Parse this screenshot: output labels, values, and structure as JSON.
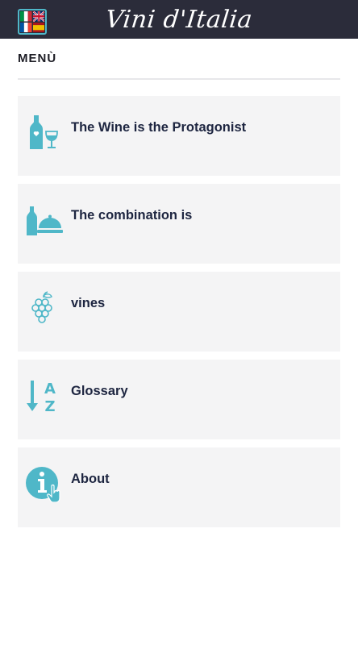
{
  "header": {
    "title": "Vini d'Italia",
    "language_button": {
      "flags": [
        "italy-flag",
        "uk-flag",
        "france-flag",
        "spain-flag"
      ]
    }
  },
  "menu": {
    "heading": "MENÙ",
    "items": [
      {
        "label": "The Wine is the Protagonist",
        "icon": "wine-bottle-glass-icon"
      },
      {
        "label": "The combination is",
        "icon": "wine-food-pairing-icon"
      },
      {
        "label": "vines",
        "icon": "grapes-icon"
      },
      {
        "label": "Glossary",
        "icon": "sort-a-z-icon"
      },
      {
        "label": "About",
        "icon": "info-touch-icon"
      }
    ]
  },
  "colors": {
    "header_bg": "#2b2c3a",
    "accent": "#4fb7c8",
    "item_bg": "#f4f4f5",
    "item_text": "#1d2540"
  }
}
